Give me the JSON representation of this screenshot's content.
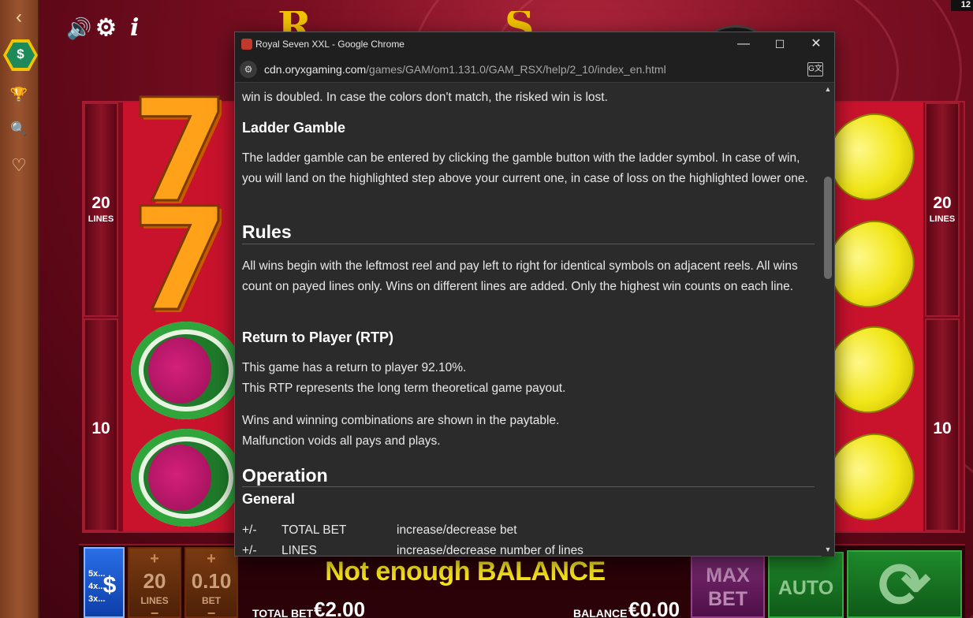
{
  "game": {
    "corner_badge": "12",
    "sidebar": {
      "back": "‹",
      "coins": "$",
      "trophy": "🏆",
      "search": "🔍",
      "favorite": "♡"
    },
    "top_controls": {
      "sound": "🔊",
      "settings": "⚙",
      "info": "i"
    },
    "reels": {
      "left_lines_top_num": "20",
      "left_lines_top_cap": "LINES",
      "left_lines_bottom_num": "10",
      "right_lines_top_num": "20",
      "right_lines_top_cap": "LINES",
      "right_lines_bottom_num": "10",
      "seven_glyph": "7"
    },
    "bottom": {
      "gamble_multipliers": [
        "5x...",
        "4x...",
        "3x..."
      ],
      "gamble_symbol": "$",
      "lines_plus": "+",
      "lines_value": "20",
      "lines_label": "LINES",
      "lines_minus": "−",
      "bet_plus": "+",
      "bet_value": "0.10",
      "bet_label": "BET",
      "bet_minus": "−",
      "message": "Not enough BALANCE",
      "total_bet_label": "TOTAL BET",
      "total_bet_value": "€2.00",
      "balance_label": "BALANCE",
      "balance_value": "€0.00",
      "max_bet_line1": "MAX",
      "max_bet_line2": "BET",
      "auto_label": "AUTO",
      "spin_icon": "⟳"
    },
    "colors": {
      "accent_yellow": "#f5e51b",
      "max_bet_purple": "#6d1f60",
      "auto_green": "#1f7a2a"
    }
  },
  "browser": {
    "window_title": "Royal Seven XXL - Google Chrome",
    "controls": {
      "minimize": "—",
      "maximize": "☐",
      "close": "✕"
    },
    "url_host": "cdn.oryxgaming.com",
    "url_path": "/games/GAM/om1.131.0/GAM_RSX/help/2_10/index_en.html",
    "translate": "G文"
  },
  "help": {
    "top_fragment": "win is doubled. In case the colors don't match, the risked win is lost.",
    "ladder_heading": "Ladder Gamble",
    "ladder_text": "The ladder gamble can be entered by clicking the gamble button with the ladder symbol. In case of win, you will land on the highlighted step above your current one, in case of loss on the highlighted lower one.",
    "rules_heading": "Rules",
    "rules_text": "All wins begin with the leftmost reel and pay left to right for identical symbols on adjacent reels. All wins count on payed lines only. Wins on different lines are added. Only the highest win counts on each line.",
    "rtp_heading": "Return to Player (RTP)",
    "rtp_line1": "This game has a return to player 92.10%.",
    "rtp_line2": "This RTP represents the long term theoretical game payout.",
    "wins_line1": "Wins and winning combinations are shown in the paytable.",
    "wins_line2": "Malfunction voids all pays and plays.",
    "operation_heading": "Operation",
    "general_heading": "General",
    "table": [
      {
        "key": "+/-",
        "name": "TOTAL BET",
        "desc": "increase/decrease bet"
      },
      {
        "key": "+/-",
        "name": "LINES",
        "desc": "increase/decrease number of lines"
      }
    ]
  }
}
